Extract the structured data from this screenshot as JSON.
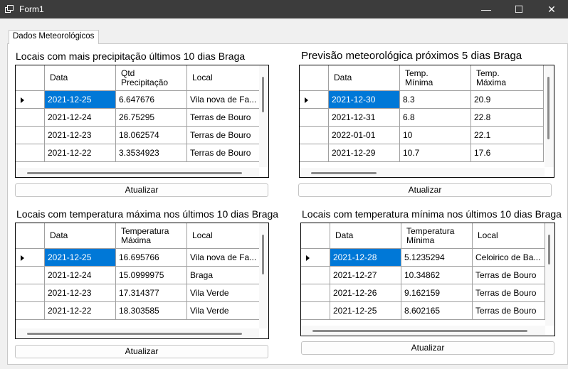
{
  "window": {
    "title": "Form1",
    "minimize": "—",
    "maximize": "☐",
    "close": "✕"
  },
  "tab": {
    "label": "Dados Meteorológicos"
  },
  "precip": {
    "title": "Locais com mais precipitação últimos 10 dias Braga",
    "headers": [
      "Data",
      "Qtd\nPrecipitação",
      "Local"
    ],
    "rows": [
      [
        "2021-12-25",
        "6.647676",
        "Vila nova de Fa..."
      ],
      [
        "2021-12-24",
        "26.75295",
        "Terras de Bouro"
      ],
      [
        "2021-12-23",
        "18.062574",
        "Terras de Bouro"
      ],
      [
        "2021-12-22",
        "3.3534923",
        "Terras de Bouro"
      ]
    ],
    "button": "Atualizar"
  },
  "forecast": {
    "title": "Previsão meteorológica próximos 5 dias Braga",
    "headers": [
      "Data",
      "Temp.\nMínima",
      "Temp.\nMáxima"
    ],
    "rows": [
      [
        "2021-12-30",
        "8.3",
        "20.9"
      ],
      [
        "2021-12-31",
        "6.8",
        "22.8"
      ],
      [
        "2022-01-01",
        "10",
        "22.1"
      ],
      [
        "2021-12-29",
        "10.7",
        "17.6"
      ]
    ],
    "button": "Atualizar"
  },
  "tmax": {
    "title": "Locais com temperatura máxima nos últimos 10 dias Braga",
    "headers": [
      "Data",
      "Temperatura\nMáxima",
      "Local"
    ],
    "rows": [
      [
        "2021-12-25",
        "16.695766",
        "Vila nova de Fa..."
      ],
      [
        "2021-12-24",
        "15.0999975",
        "Braga"
      ],
      [
        "2021-12-23",
        "17.314377",
        "Vila Verde"
      ],
      [
        "2021-12-22",
        "18.303585",
        "Vila Verde"
      ]
    ],
    "button": "Atualizar"
  },
  "tmin": {
    "title": "Locais com temperatura mínima nos últimos 10 dias Braga",
    "headers": [
      "Data",
      "Temperatura\nMínima",
      "Local"
    ],
    "rows": [
      [
        "2021-12-28",
        "5.1235294",
        "Celoirico de Ba..."
      ],
      [
        "2021-12-27",
        "10.34862",
        "Terras de Bouro"
      ],
      [
        "2021-12-26",
        "9.162159",
        "Terras de Bouro"
      ],
      [
        "2021-12-25",
        "8.602165",
        "Terras de Bouro"
      ]
    ],
    "button": "Atualizar"
  }
}
